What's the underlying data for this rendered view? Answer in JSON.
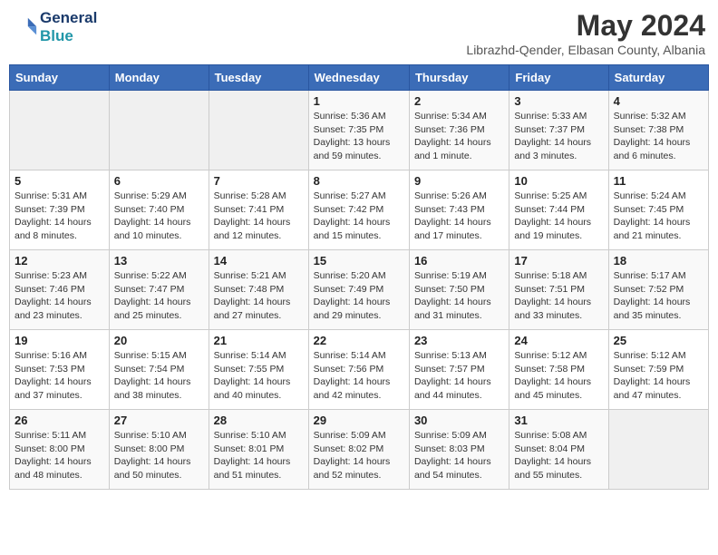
{
  "header": {
    "logo_line1": "General",
    "logo_line2": "Blue",
    "month_title": "May 2024",
    "subtitle": "Librazhd-Qender, Elbasan County, Albania"
  },
  "days_of_week": [
    "Sunday",
    "Monday",
    "Tuesday",
    "Wednesday",
    "Thursday",
    "Friday",
    "Saturday"
  ],
  "weeks": [
    [
      {
        "day": "",
        "info": ""
      },
      {
        "day": "",
        "info": ""
      },
      {
        "day": "",
        "info": ""
      },
      {
        "day": "1",
        "info": "Sunrise: 5:36 AM\nSunset: 7:35 PM\nDaylight: 13 hours\nand 59 minutes."
      },
      {
        "day": "2",
        "info": "Sunrise: 5:34 AM\nSunset: 7:36 PM\nDaylight: 14 hours\nand 1 minute."
      },
      {
        "day": "3",
        "info": "Sunrise: 5:33 AM\nSunset: 7:37 PM\nDaylight: 14 hours\nand 3 minutes."
      },
      {
        "day": "4",
        "info": "Sunrise: 5:32 AM\nSunset: 7:38 PM\nDaylight: 14 hours\nand 6 minutes."
      }
    ],
    [
      {
        "day": "5",
        "info": "Sunrise: 5:31 AM\nSunset: 7:39 PM\nDaylight: 14 hours\nand 8 minutes."
      },
      {
        "day": "6",
        "info": "Sunrise: 5:29 AM\nSunset: 7:40 PM\nDaylight: 14 hours\nand 10 minutes."
      },
      {
        "day": "7",
        "info": "Sunrise: 5:28 AM\nSunset: 7:41 PM\nDaylight: 14 hours\nand 12 minutes."
      },
      {
        "day": "8",
        "info": "Sunrise: 5:27 AM\nSunset: 7:42 PM\nDaylight: 14 hours\nand 15 minutes."
      },
      {
        "day": "9",
        "info": "Sunrise: 5:26 AM\nSunset: 7:43 PM\nDaylight: 14 hours\nand 17 minutes."
      },
      {
        "day": "10",
        "info": "Sunrise: 5:25 AM\nSunset: 7:44 PM\nDaylight: 14 hours\nand 19 minutes."
      },
      {
        "day": "11",
        "info": "Sunrise: 5:24 AM\nSunset: 7:45 PM\nDaylight: 14 hours\nand 21 minutes."
      }
    ],
    [
      {
        "day": "12",
        "info": "Sunrise: 5:23 AM\nSunset: 7:46 PM\nDaylight: 14 hours\nand 23 minutes."
      },
      {
        "day": "13",
        "info": "Sunrise: 5:22 AM\nSunset: 7:47 PM\nDaylight: 14 hours\nand 25 minutes."
      },
      {
        "day": "14",
        "info": "Sunrise: 5:21 AM\nSunset: 7:48 PM\nDaylight: 14 hours\nand 27 minutes."
      },
      {
        "day": "15",
        "info": "Sunrise: 5:20 AM\nSunset: 7:49 PM\nDaylight: 14 hours\nand 29 minutes."
      },
      {
        "day": "16",
        "info": "Sunrise: 5:19 AM\nSunset: 7:50 PM\nDaylight: 14 hours\nand 31 minutes."
      },
      {
        "day": "17",
        "info": "Sunrise: 5:18 AM\nSunset: 7:51 PM\nDaylight: 14 hours\nand 33 minutes."
      },
      {
        "day": "18",
        "info": "Sunrise: 5:17 AM\nSunset: 7:52 PM\nDaylight: 14 hours\nand 35 minutes."
      }
    ],
    [
      {
        "day": "19",
        "info": "Sunrise: 5:16 AM\nSunset: 7:53 PM\nDaylight: 14 hours\nand 37 minutes."
      },
      {
        "day": "20",
        "info": "Sunrise: 5:15 AM\nSunset: 7:54 PM\nDaylight: 14 hours\nand 38 minutes."
      },
      {
        "day": "21",
        "info": "Sunrise: 5:14 AM\nSunset: 7:55 PM\nDaylight: 14 hours\nand 40 minutes."
      },
      {
        "day": "22",
        "info": "Sunrise: 5:14 AM\nSunset: 7:56 PM\nDaylight: 14 hours\nand 42 minutes."
      },
      {
        "day": "23",
        "info": "Sunrise: 5:13 AM\nSunset: 7:57 PM\nDaylight: 14 hours\nand 44 minutes."
      },
      {
        "day": "24",
        "info": "Sunrise: 5:12 AM\nSunset: 7:58 PM\nDaylight: 14 hours\nand 45 minutes."
      },
      {
        "day": "25",
        "info": "Sunrise: 5:12 AM\nSunset: 7:59 PM\nDaylight: 14 hours\nand 47 minutes."
      }
    ],
    [
      {
        "day": "26",
        "info": "Sunrise: 5:11 AM\nSunset: 8:00 PM\nDaylight: 14 hours\nand 48 minutes."
      },
      {
        "day": "27",
        "info": "Sunrise: 5:10 AM\nSunset: 8:00 PM\nDaylight: 14 hours\nand 50 minutes."
      },
      {
        "day": "28",
        "info": "Sunrise: 5:10 AM\nSunset: 8:01 PM\nDaylight: 14 hours\nand 51 minutes."
      },
      {
        "day": "29",
        "info": "Sunrise: 5:09 AM\nSunset: 8:02 PM\nDaylight: 14 hours\nand 52 minutes."
      },
      {
        "day": "30",
        "info": "Sunrise: 5:09 AM\nSunset: 8:03 PM\nDaylight: 14 hours\nand 54 minutes."
      },
      {
        "day": "31",
        "info": "Sunrise: 5:08 AM\nSunset: 8:04 PM\nDaylight: 14 hours\nand 55 minutes."
      },
      {
        "day": "",
        "info": ""
      }
    ]
  ]
}
